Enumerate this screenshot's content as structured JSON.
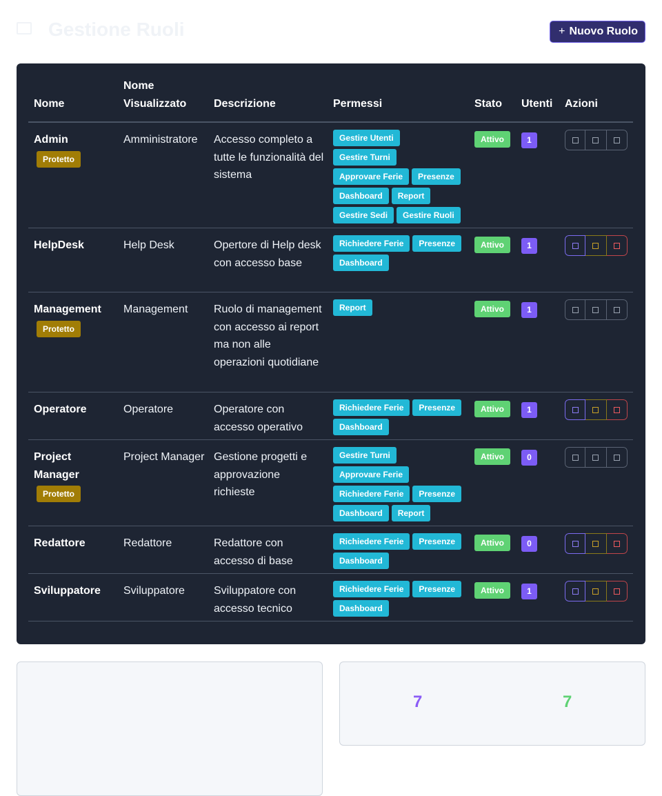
{
  "header": {
    "title": "Gestione Ruoli",
    "new_button": "+ Nuovo Ruolo",
    "plus": "+",
    "new_label": "Nuovo Ruolo"
  },
  "table": {
    "columns": [
      "Nome",
      "Nome Visualizzato",
      "Descrizione",
      "Permessi",
      "Stato",
      "Utenti",
      "Azioni"
    ],
    "rows": [
      {
        "nome": "Admin",
        "protected": "Protetto",
        "nome_visualizzato": "Amministratore",
        "descrizione": "Accesso completo a tutte le funzionalità del sistema",
        "permessi": [
          "Gestire Utenti",
          "Gestire Turni",
          "Approvare Ferie",
          "Presenze",
          "Dashboard",
          "Report",
          "Gestire Sedi",
          "Gestire Ruoli"
        ],
        "stato": "Attivo",
        "utenti": "1",
        "actions_enabled": false
      },
      {
        "nome": "HelpDesk",
        "protected": "",
        "nome_visualizzato": "Help Desk",
        "descrizione": "Opertore di Help desk con accesso base",
        "permessi": [
          "Richiedere Ferie",
          "Presenze",
          "Dashboard"
        ],
        "stato": "Attivo",
        "utenti": "1",
        "actions_enabled": true
      },
      {
        "nome": "Management",
        "protected": "Protetto",
        "nome_visualizzato": "Management",
        "descrizione": "Ruolo di management con accesso ai report ma non alle operazioni quotidiane",
        "permessi": [
          "Report"
        ],
        "stato": "Attivo",
        "utenti": "1",
        "actions_enabled": false
      },
      {
        "nome": "Operatore",
        "protected": "",
        "nome_visualizzato": "Operatore",
        "descrizione": "Operatore con accesso operativo",
        "permessi": [
          "Richiedere Ferie",
          "Presenze",
          "Dashboard"
        ],
        "stato": "Attivo",
        "utenti": "1",
        "actions_enabled": true
      },
      {
        "nome": "Project Manager",
        "protected": "Protetto",
        "nome_visualizzato": "Project Manager",
        "descrizione": "Gestione progetti e approvazione richieste",
        "permessi": [
          "Gestire Turni",
          "Approvare Ferie",
          "Richiedere Ferie",
          "Presenze",
          "Dashboard",
          "Report"
        ],
        "stato": "Attivo",
        "utenti": "0",
        "actions_enabled": false
      },
      {
        "nome": "Redattore",
        "protected": "",
        "nome_visualizzato": "Redattore",
        "descrizione": "Redattore con accesso di base",
        "permessi": [
          "Richiedere Ferie",
          "Presenze",
          "Dashboard"
        ],
        "stato": "Attivo",
        "utenti": "0",
        "actions_enabled": true
      },
      {
        "nome": "Sviluppatore",
        "protected": "",
        "nome_visualizzato": "Sviluppatore",
        "descrizione": "Sviluppatore con accesso tecnico",
        "permessi": [
          "Richiedere Ferie",
          "Presenze",
          "Dashboard"
        ],
        "stato": "Attivo",
        "utenti": "1",
        "actions_enabled": true
      }
    ]
  },
  "stats": {
    "total_roles": "7",
    "active_roles": "7"
  },
  "colors": {
    "panel": "#1e2533",
    "permission_badge": "#22b8d6",
    "status_active": "#5fd274",
    "users_badge": "#7c5cf5",
    "protected_badge": "#a17d06",
    "primary_button": "#312e6e"
  }
}
